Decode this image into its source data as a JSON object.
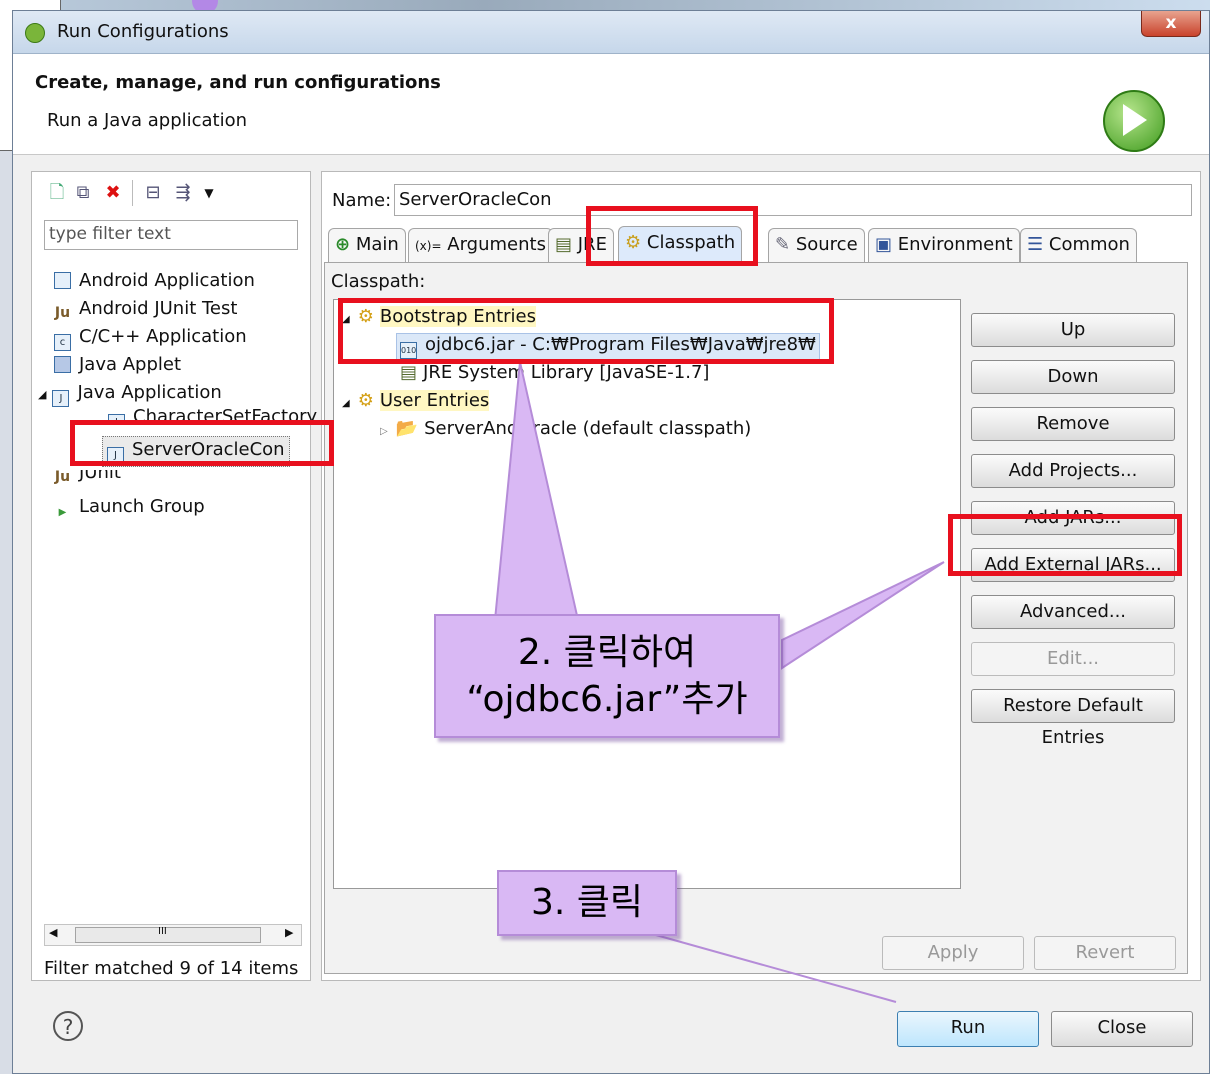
{
  "window": {
    "title": "Run Configurations",
    "close": "x"
  },
  "header": {
    "title": "Create, manage, and run configurations",
    "subtitle": "Run a Java application"
  },
  "left": {
    "filter_placeholder": "type filter text",
    "tree": {
      "android_app": "Android Application",
      "android_junit": "Android JUnit Test",
      "cpp_app": "C/C++ Application",
      "java_applet": "Java Applet",
      "java_app": "Java Application",
      "charset_factory": "CharacterSetFactory",
      "server_oracle_con": "ServerOracleCon",
      "junit": "JUnit",
      "launch_group": "Launch Group"
    },
    "scroll_mark": "III",
    "filter_status": "Filter matched 9 of 14 items"
  },
  "right": {
    "name_label": "Name:",
    "name_value": "ServerOracleCon",
    "tabs": {
      "main": "Main",
      "arguments": "Arguments",
      "jre": "JRE",
      "classpath": "Classpath",
      "source": "Source",
      "environment": "Environment",
      "common": "Common"
    },
    "classpath_label": "Classpath:",
    "entries": {
      "bootstrap": "Bootstrap Entries",
      "ojdbc": "ojdbc6.jar - C:₩Program Files₩Java₩jre8₩",
      "jre_lib": "JRE System Library [JavaSE-1.7]",
      "user": "User Entries",
      "server_and_oracle": "ServerAndOracle (default classpath)"
    },
    "buttons": {
      "up": "Up",
      "down": "Down",
      "remove": "Remove",
      "add_projects": "Add Projects...",
      "add_jars": "Add JARs...",
      "add_external_jars": "Add External JARs...",
      "advanced": "Advanced...",
      "edit": "Edit...",
      "restore": "Restore Default Entries",
      "apply": "Apply",
      "revert": "Revert"
    }
  },
  "footer": {
    "help": "?",
    "run": "Run",
    "close": "Close"
  },
  "annotations": {
    "step2_line1": "2. 클릭하여",
    "step2_line2": "“ojdbc6.jar”추가",
    "step3": "3. 클릭"
  }
}
